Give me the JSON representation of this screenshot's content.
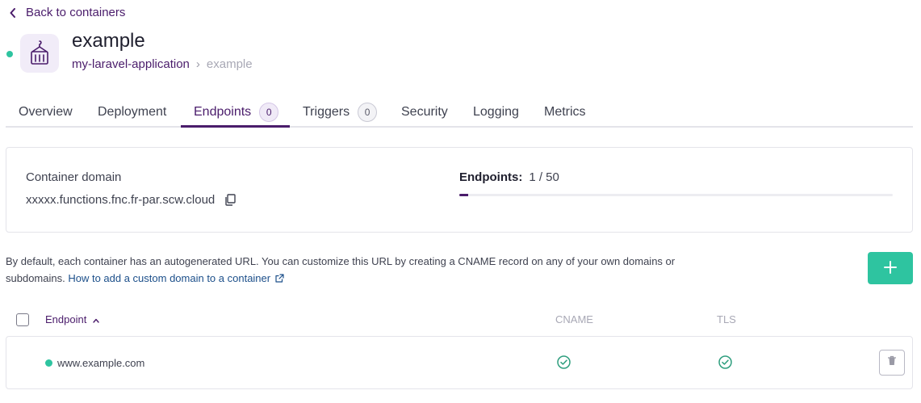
{
  "back_link": {
    "label": "Back to containers"
  },
  "header": {
    "title": "example",
    "breadcrumb": {
      "namespace": "my-laravel-application",
      "separator": "›",
      "current": "example"
    }
  },
  "tabs": [
    {
      "label": "Overview"
    },
    {
      "label": "Deployment"
    },
    {
      "label": "Endpoints",
      "badge": "0",
      "active": true
    },
    {
      "label": "Triggers",
      "badge": "0"
    },
    {
      "label": "Security"
    },
    {
      "label": "Logging"
    },
    {
      "label": "Metrics"
    }
  ],
  "domain_card": {
    "label": "Container domain",
    "domain": "xxxxx.functions.fnc.fr-par.scw.cloud",
    "quota_label": "Endpoints:",
    "quota_value": "1 / 50",
    "quota_fraction": 0.02
  },
  "description": {
    "text": "By default, each container has an autogenerated URL. You can customize this URL by creating a CNAME record on any of your own domains or subdomains.",
    "link": "How to add a custom domain to a container"
  },
  "table": {
    "columns": {
      "endpoint": "Endpoint",
      "cname": "CNAME",
      "tls": "TLS"
    },
    "rows": [
      {
        "endpoint": "www.example.com",
        "status": "active",
        "cname": "check-circle-icon",
        "tls": "check-circle-icon"
      }
    ]
  },
  "colors": {
    "brand": "#4a1c6b",
    "accent": "#2ec4a0",
    "link": "#1c4f8a"
  }
}
